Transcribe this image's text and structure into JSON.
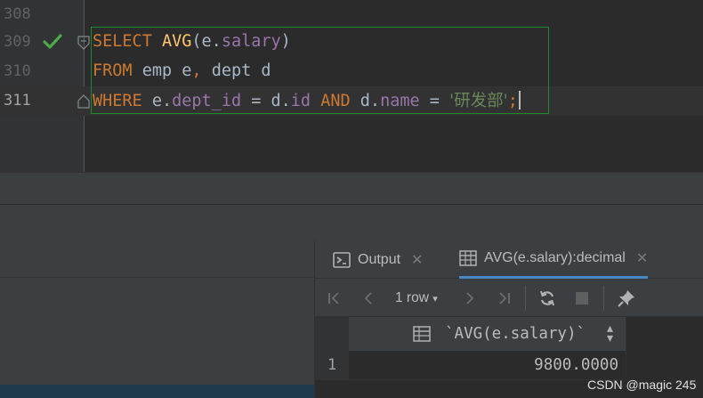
{
  "editor": {
    "lines": [
      {
        "number": "308",
        "tokens": []
      },
      {
        "number": "309",
        "tokens": [
          "SELECT",
          "AVG",
          "(e.",
          "salary",
          ")"
        ]
      },
      {
        "number": "310",
        "tokens": [
          "FROM",
          "emp e",
          ",",
          "dept d"
        ]
      },
      {
        "number": "311",
        "tokens": [
          "WHERE",
          "e.",
          "dept_id",
          "=",
          "d.",
          "id",
          "AND",
          "d.",
          "name",
          "=",
          "'研发部'",
          ";"
        ]
      }
    ]
  },
  "results": {
    "tabs": [
      {
        "label": "Output",
        "icon": "console-icon"
      },
      {
        "label": "AVG(e.salary):decimal",
        "icon": "table-icon"
      }
    ],
    "toolbar": {
      "rows_label": "1 row"
    },
    "columns": [
      {
        "label": "`AVG(e.salary)`"
      }
    ],
    "rows": [
      {
        "num": "1",
        "cells": [
          "9800.0000"
        ]
      }
    ]
  },
  "watermark": "CSDN @magic 245",
  "colors": {
    "keyword": "#cc7832",
    "function": "#ffc66d",
    "field": "#9876aa",
    "string": "#6a8759",
    "selection_border": "#1e8a2a",
    "check": "#4eaa47"
  }
}
